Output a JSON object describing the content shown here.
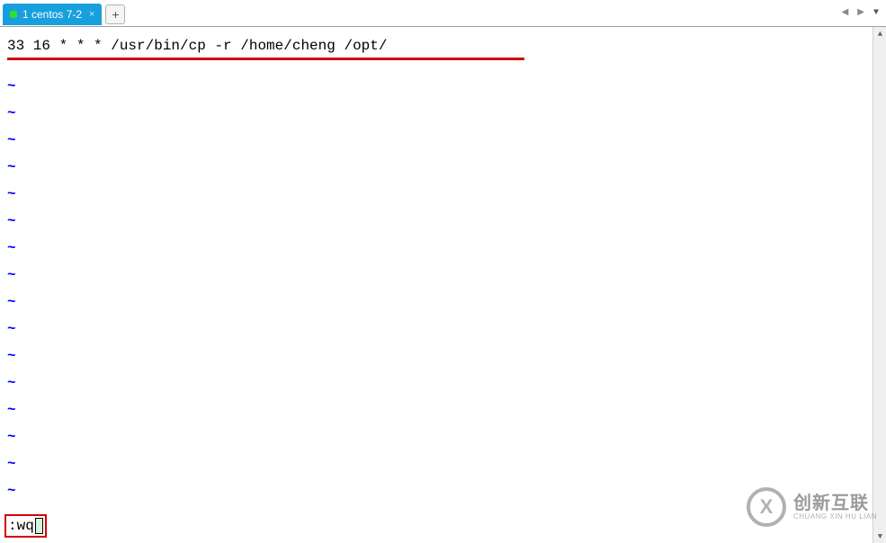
{
  "tabbar": {
    "tab_label": "1 centos 7-2",
    "close_glyph": "×",
    "add_glyph": "+",
    "nav_left": "◀",
    "nav_right": "▶",
    "dropdown": "▼"
  },
  "editor": {
    "content_line": "33 16 * * * /usr/bin/cp -r /home/cheng /opt/",
    "tilde": "~",
    "tilde_count": 16,
    "command": ":wq"
  },
  "scrollbar": {
    "up": "▲",
    "down": "▼"
  },
  "watermark": {
    "logo_letter": "X",
    "cn": "创新互联",
    "en": "CHUANG XIN HU LIAN"
  }
}
